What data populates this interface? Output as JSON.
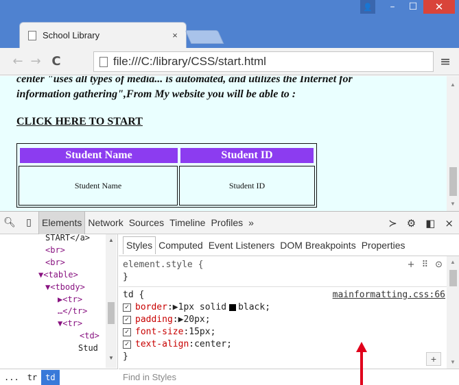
{
  "window": {
    "user_glyph": "👤",
    "minimize": "–",
    "maximize": "☐",
    "close": "✕"
  },
  "tab": {
    "title": "School Library",
    "close": "×"
  },
  "toolbar": {
    "back": "←",
    "forward": "→",
    "reload": "C",
    "url": "file:///C:/library/CSS/start.html",
    "menu": "≡"
  },
  "page": {
    "intro_line1": "center \"uses all types of media... is automated, and utilizes the Internet for",
    "intro_line2": "information gathering\",From My website you will be able to :",
    "start_link": "CLICK HERE TO START",
    "table": {
      "headers": [
        "Student Name",
        "Student ID"
      ],
      "cells": [
        "Student Name",
        "Student ID"
      ]
    }
  },
  "devtools": {
    "tabs": [
      "Elements",
      "Network",
      "Sources",
      "Timeline",
      "Profiles",
      "»"
    ],
    "dom_lines": [
      {
        "text": "START</a>"
      },
      {
        "text": "<br>"
      },
      {
        "text": "<br>"
      },
      {
        "text": "▼<table>"
      },
      {
        "text": "▼<tbody>"
      },
      {
        "text": "▶<tr>"
      },
      {
        "text": "…</tr>"
      },
      {
        "text": "▼<tr>"
      },
      {
        "text": "<td>"
      },
      {
        "text": "Stud"
      }
    ],
    "breadcrumbs": [
      "...",
      "tr",
      "td"
    ],
    "styles_tabs": [
      "Styles",
      "Computed",
      "Event Listeners",
      "DOM Breakpoints",
      "Properties"
    ],
    "element_style": "element.style {",
    "close_brace": "}",
    "rule_selector": "td {",
    "rule_source": "mainformatting.css:66",
    "properties": [
      {
        "name": "border",
        "value": "▶1px solid",
        "swatch": true,
        "after": "black;"
      },
      {
        "name": "padding",
        "value": "▶20px;"
      },
      {
        "name": "font-size",
        "value": " 15px;"
      },
      {
        "name": "text-align",
        "value": " center;"
      }
    ],
    "find_placeholder": "Find in Styles",
    "plus": "+"
  },
  "colors": {
    "titlebar": "#4f82d0",
    "page_bg": "#eaffff",
    "table_header": "#8c3cf0",
    "annotation_arrow": "#e0001b"
  }
}
